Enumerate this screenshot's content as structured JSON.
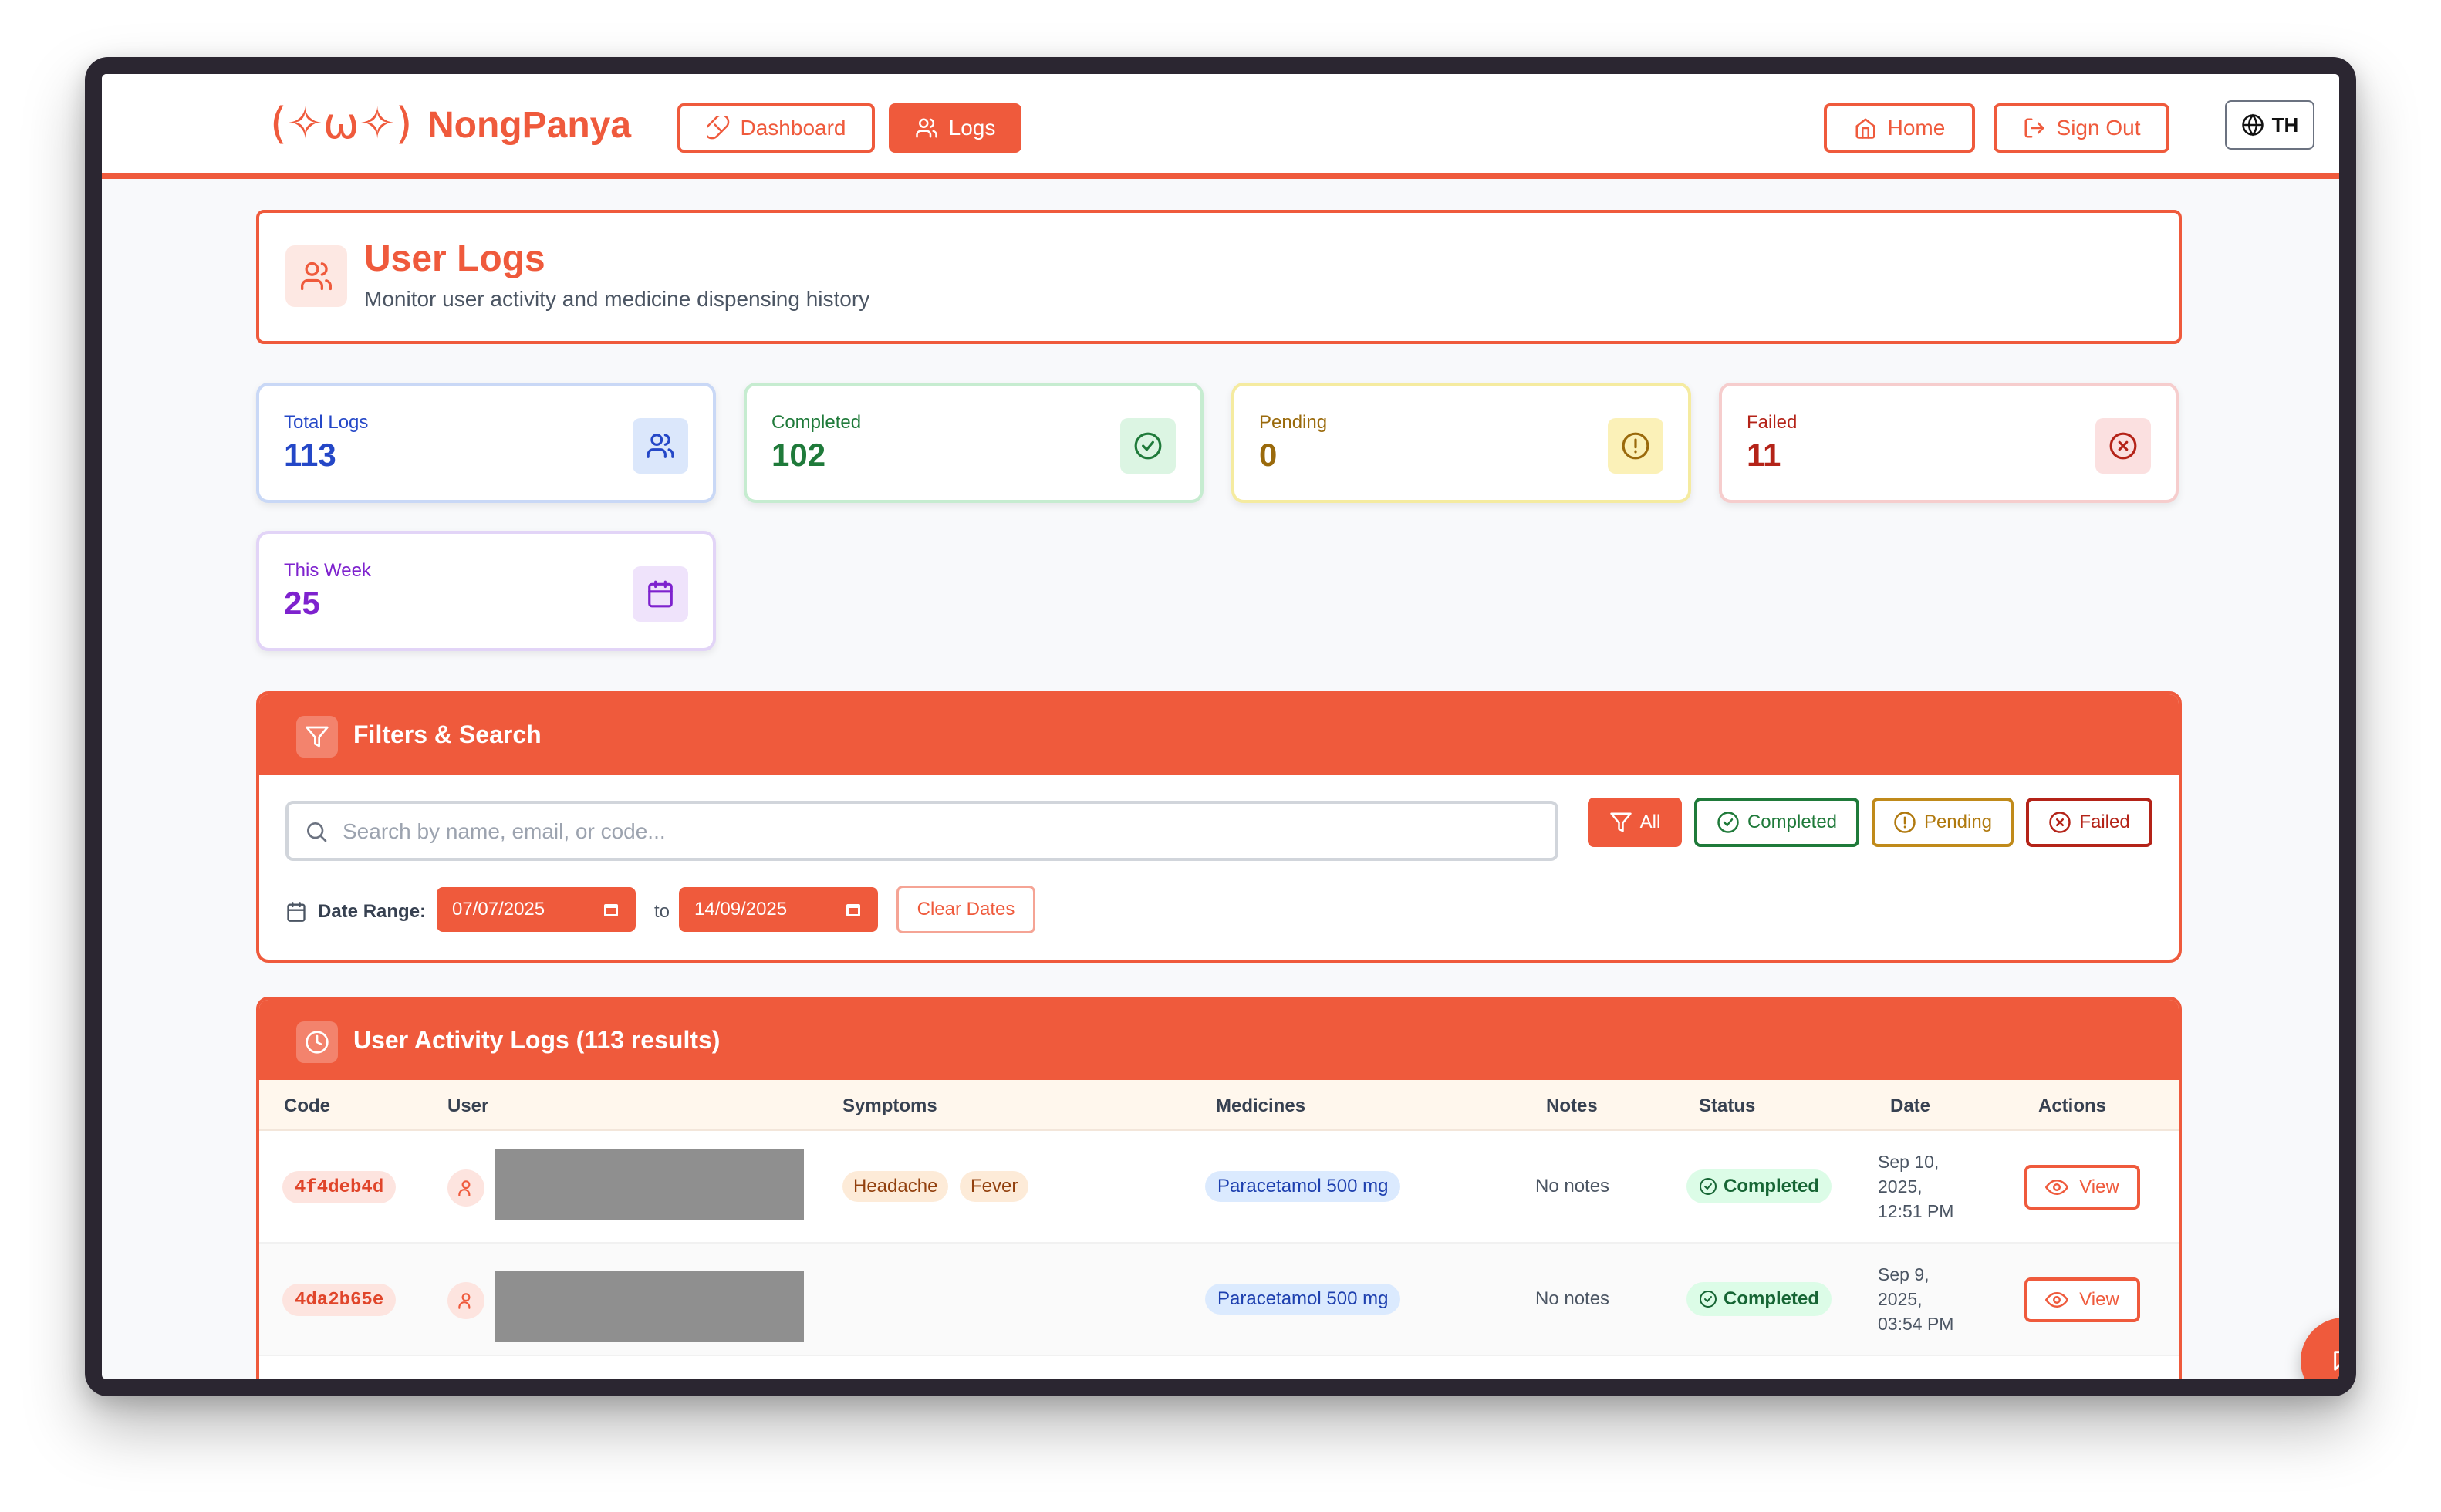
{
  "brand": {
    "face": "(✧ω✧)",
    "name": "NongPanya"
  },
  "nav": {
    "dashboard": "Dashboard",
    "logs": "Logs",
    "home": "Home",
    "sign_out": "Sign Out",
    "language": "TH"
  },
  "page": {
    "title": "User Logs",
    "subtitle": "Monitor user activity and medicine dispensing history"
  },
  "stats": {
    "total": {
      "label": "Total Logs",
      "value": "113",
      "color": "#2447c7"
    },
    "completed": {
      "label": "Completed",
      "value": "102",
      "color": "#1f7a3a"
    },
    "pending": {
      "label": "Pending",
      "value": "0",
      "color": "#9a6a0c"
    },
    "failed": {
      "label": "Failed",
      "value": "11",
      "color": "#b42318"
    },
    "week": {
      "label": "This Week",
      "value": "25",
      "color": "#7e22ce"
    }
  },
  "filters": {
    "title": "Filters & Search",
    "search_placeholder": "Search by name, email, or code...",
    "all": "All",
    "completed": "Completed",
    "pending": "Pending",
    "failed": "Failed",
    "date_range_label": "Date Range:",
    "date_from": "07/07/2025",
    "to": "to",
    "date_to": "14/09/2025",
    "clear_dates": "Clear Dates"
  },
  "logs": {
    "title": "User Activity Logs (113 results)",
    "columns": [
      "Code",
      "User",
      "Symptoms",
      "Medicines",
      "Notes",
      "Status",
      "Date",
      "Actions"
    ],
    "rows": [
      {
        "code": "4f4deb4d",
        "symptoms": [
          "Headache",
          "Fever"
        ],
        "medicine": "Paracetamol 500 mg",
        "notes": "No notes",
        "status": "Completed",
        "date": "Sep 10,\n2025,\n12:51 PM",
        "action": "View"
      },
      {
        "code": "4da2b65e",
        "symptoms": [],
        "medicine": "Paracetamol 500 mg",
        "notes": "No notes",
        "status": "Completed",
        "date": "Sep 9,\n2025,\n03:54 PM",
        "action": "View"
      }
    ]
  },
  "colors": {
    "accent": "#ef5a3c",
    "success": "#166534"
  },
  "icons": [
    "pill-icon",
    "users-icon",
    "home-icon",
    "sign-out-icon",
    "globe-icon",
    "check-circle-icon",
    "alert-circle-icon",
    "x-circle-icon",
    "calendar-icon",
    "filter-icon",
    "search-icon",
    "clock-icon",
    "user-icon",
    "eye-icon",
    "chat-icon"
  ]
}
